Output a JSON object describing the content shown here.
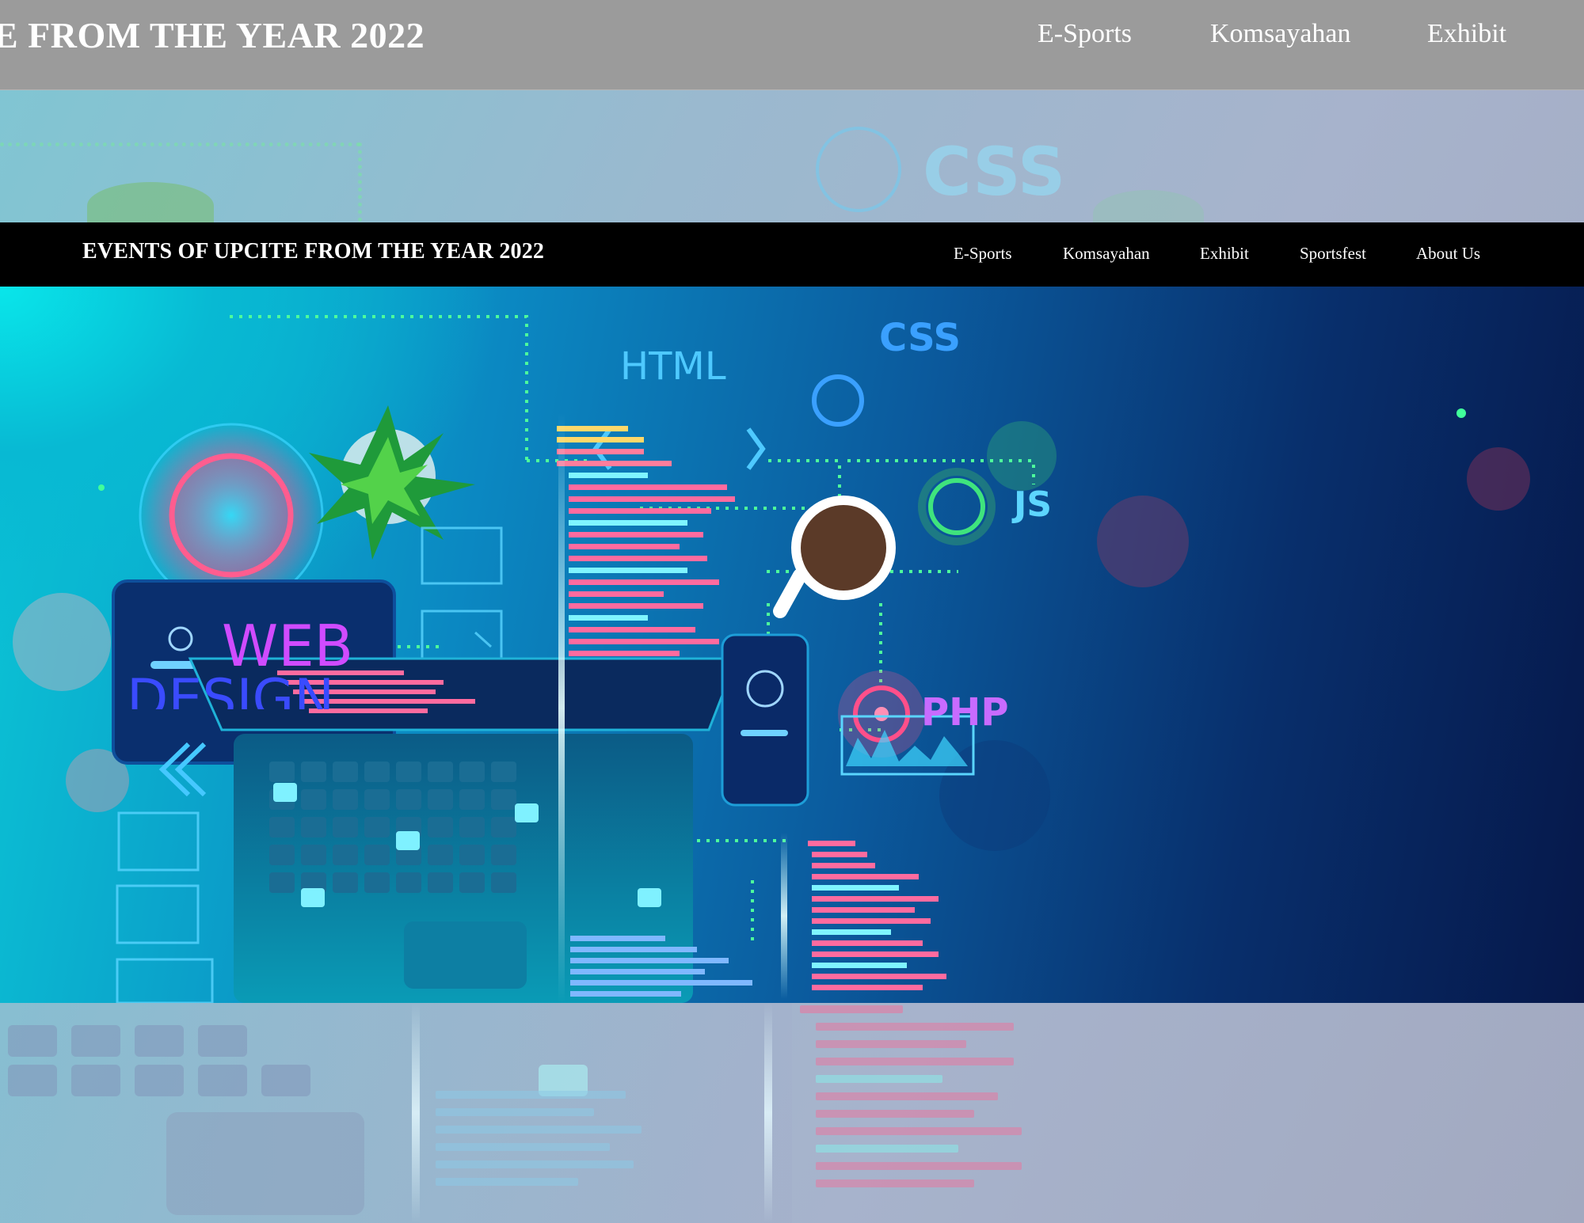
{
  "background_page": {
    "title": "E FROM THE YEAR 2022",
    "nav": [
      "E-Sports",
      "Komsayahan",
      "Exhibit"
    ],
    "css_label": "CSS"
  },
  "navbar": {
    "brand": "EVENTS OF UPCITE FROM THE YEAR 2022",
    "links": [
      "E-Sports",
      "Komsayahan",
      "Exhibit",
      "Sportsfest",
      "About Us"
    ]
  },
  "hero": {
    "labels": {
      "html": "HTML",
      "css": "CSS",
      "js": "JS",
      "php": "PHP",
      "web": "WEB",
      "design": "DESIGN"
    }
  },
  "colors": {
    "navbar_bg": "#000000",
    "bg_topbar": "#9b9b9b",
    "html_label": "#4ec9ff",
    "css_label": "#3aa0ff",
    "js_label": "#5dd6ff",
    "php_label": "#c86bff",
    "web_label": "#d04bff"
  }
}
